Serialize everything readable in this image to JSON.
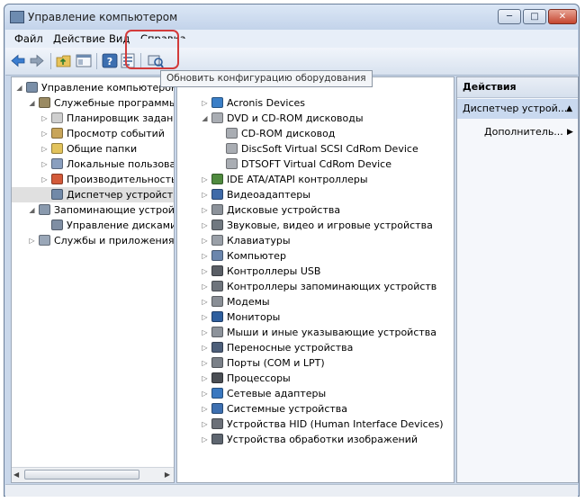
{
  "window": {
    "title": "Управление компьютером"
  },
  "menu": [
    "Файл",
    "Действие",
    "Вид",
    "Справка"
  ],
  "tooltip": "Обновить конфигурацию оборудования",
  "left_tree": [
    {
      "label": "Управление компьютером",
      "icon": "computer-management-icon",
      "indent": 0,
      "expander": "open"
    },
    {
      "label": "Служебные программы",
      "icon": "tools-icon",
      "indent": 1,
      "expander": "open"
    },
    {
      "label": "Планировщик заданий",
      "icon": "clock-icon",
      "indent": 2,
      "expander": "closed"
    },
    {
      "label": "Просмотр событий",
      "icon": "event-viewer-icon",
      "indent": 2,
      "expander": "closed"
    },
    {
      "label": "Общие папки",
      "icon": "shared-folders-icon",
      "indent": 2,
      "expander": "closed"
    },
    {
      "label": "Локальные пользовате",
      "icon": "users-icon",
      "indent": 2,
      "expander": "closed"
    },
    {
      "label": "Производительность",
      "icon": "performance-icon",
      "indent": 2,
      "expander": "closed"
    },
    {
      "label": "Диспетчер устройств",
      "icon": "device-manager-icon",
      "indent": 2,
      "expander": "none",
      "selected": true
    },
    {
      "label": "Запоминающие устройст",
      "icon": "storage-icon",
      "indent": 1,
      "expander": "open"
    },
    {
      "label": "Управление дисками",
      "icon": "disk-management-icon",
      "indent": 2,
      "expander": "none"
    },
    {
      "label": "Службы и приложения",
      "icon": "services-icon",
      "indent": 1,
      "expander": "closed"
    }
  ],
  "device_tree": [
    {
      "label": "Acronis Devices",
      "icon": "network-device-icon",
      "indent": 0,
      "expander": "closed"
    },
    {
      "label": "DVD и CD-ROM дисководы",
      "icon": "dvd-drive-icon",
      "indent": 0,
      "expander": "open"
    },
    {
      "label": "CD-ROM дисковод",
      "icon": "dvd-drive-icon",
      "indent": 1,
      "expander": "none"
    },
    {
      "label": "DiscSoft Virtual SCSI CdRom Device",
      "icon": "dvd-drive-icon",
      "indent": 1,
      "expander": "none"
    },
    {
      "label": "DTSOFT Virtual CdRom Device",
      "icon": "dvd-drive-icon",
      "indent": 1,
      "expander": "none"
    },
    {
      "label": "IDE ATA/ATAPI контроллеры",
      "icon": "ide-controller-icon",
      "indent": 0,
      "expander": "closed"
    },
    {
      "label": "Видеоадаптеры",
      "icon": "display-adapter-icon",
      "indent": 0,
      "expander": "closed"
    },
    {
      "label": "Дисковые устройства",
      "icon": "disk-drive-icon",
      "indent": 0,
      "expander": "closed"
    },
    {
      "label": "Звуковые, видео и игровые устройства",
      "icon": "sound-icon",
      "indent": 0,
      "expander": "closed"
    },
    {
      "label": "Клавиатуры",
      "icon": "keyboard-icon",
      "indent": 0,
      "expander": "closed"
    },
    {
      "label": "Компьютер",
      "icon": "computer-icon",
      "indent": 0,
      "expander": "closed"
    },
    {
      "label": "Контроллеры USB",
      "icon": "usb-icon",
      "indent": 0,
      "expander": "closed"
    },
    {
      "label": "Контроллеры запоминающих устройств",
      "icon": "storage-controller-icon",
      "indent": 0,
      "expander": "closed"
    },
    {
      "label": "Модемы",
      "icon": "modem-icon",
      "indent": 0,
      "expander": "closed"
    },
    {
      "label": "Мониторы",
      "icon": "monitor-icon",
      "indent": 0,
      "expander": "closed"
    },
    {
      "label": "Мыши и иные указывающие устройства",
      "icon": "mouse-icon",
      "indent": 0,
      "expander": "closed"
    },
    {
      "label": "Переносные устройства",
      "icon": "portable-device-icon",
      "indent": 0,
      "expander": "closed"
    },
    {
      "label": "Порты (COM и LPT)",
      "icon": "port-icon",
      "indent": 0,
      "expander": "closed"
    },
    {
      "label": "Процессоры",
      "icon": "processor-icon",
      "indent": 0,
      "expander": "closed"
    },
    {
      "label": "Сетевые адаптеры",
      "icon": "network-adapter-icon",
      "indent": 0,
      "expander": "closed"
    },
    {
      "label": "Системные устройства",
      "icon": "system-device-icon",
      "indent": 0,
      "expander": "closed"
    },
    {
      "label": "Устройства HID (Human Interface Devices)",
      "icon": "hid-icon",
      "indent": 0,
      "expander": "closed"
    },
    {
      "label": "Устройства обработки изображений",
      "icon": "imaging-device-icon",
      "indent": 0,
      "expander": "closed"
    }
  ],
  "actions": {
    "header": "Действия",
    "selected": "Диспетчер устрой...",
    "more": "Дополнитель..."
  },
  "icon_colors": {
    "computer-management-icon": "#7a8fa8",
    "tools-icon": "#9a8a62",
    "clock-icon": "#cfcfcf",
    "event-viewer-icon": "#c8a55a",
    "shared-folders-icon": "#e2c35c",
    "users-icon": "#8a9fbf",
    "performance-icon": "#d35a3a",
    "device-manager-icon": "#7189a8",
    "storage-icon": "#8a9aae",
    "disk-management-icon": "#7f8ea3",
    "services-icon": "#9aa7b8",
    "network-device-icon": "#3b7fc7",
    "dvd-drive-icon": "#a9adb3",
    "ide-controller-icon": "#4f8a3f",
    "display-adapter-icon": "#3f6aa8",
    "disk-drive-icon": "#8c929a",
    "sound-icon": "#707880",
    "keyboard-icon": "#9aa0a8",
    "computer-icon": "#6b86ad",
    "usb-icon": "#5a5f66",
    "storage-controller-icon": "#6e747c",
    "modem-icon": "#8a8f96",
    "monitor-icon": "#2f5f9e",
    "mouse-icon": "#8d939b",
    "portable-device-icon": "#4d5f7a",
    "port-icon": "#7a8088",
    "processor-icon": "#4a4e54",
    "network-adapter-icon": "#3a78c0",
    "system-device-icon": "#3d6fb0",
    "hid-icon": "#6b7078",
    "imaging-device-icon": "#5e6670"
  }
}
